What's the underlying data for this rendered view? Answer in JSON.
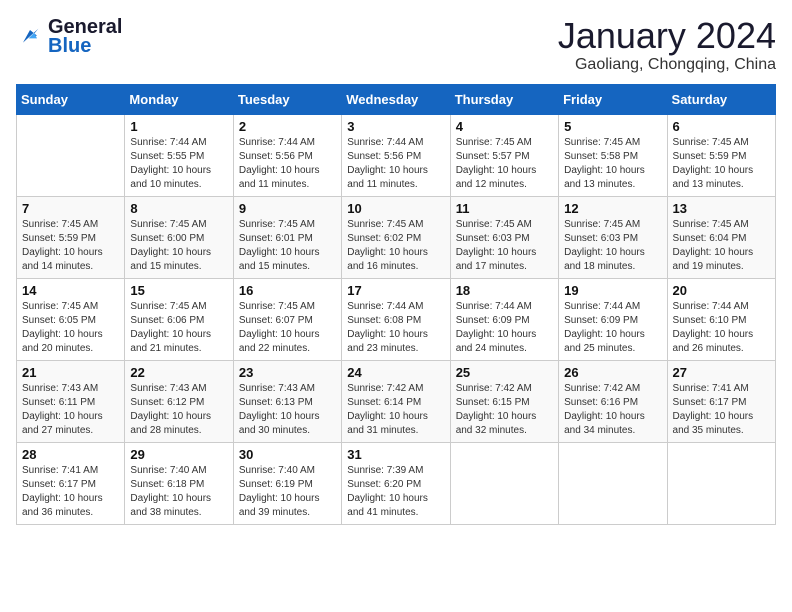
{
  "header": {
    "logo_line1": "General",
    "logo_line2": "Blue",
    "title": "January 2024",
    "subtitle": "Gaoliang, Chongqing, China"
  },
  "weekdays": [
    "Sunday",
    "Monday",
    "Tuesday",
    "Wednesday",
    "Thursday",
    "Friday",
    "Saturday"
  ],
  "weeks": [
    [
      {
        "day": "",
        "info": ""
      },
      {
        "day": "1",
        "info": "Sunrise: 7:44 AM\nSunset: 5:55 PM\nDaylight: 10 hours\nand 10 minutes."
      },
      {
        "day": "2",
        "info": "Sunrise: 7:44 AM\nSunset: 5:56 PM\nDaylight: 10 hours\nand 11 minutes."
      },
      {
        "day": "3",
        "info": "Sunrise: 7:44 AM\nSunset: 5:56 PM\nDaylight: 10 hours\nand 11 minutes."
      },
      {
        "day": "4",
        "info": "Sunrise: 7:45 AM\nSunset: 5:57 PM\nDaylight: 10 hours\nand 12 minutes."
      },
      {
        "day": "5",
        "info": "Sunrise: 7:45 AM\nSunset: 5:58 PM\nDaylight: 10 hours\nand 13 minutes."
      },
      {
        "day": "6",
        "info": "Sunrise: 7:45 AM\nSunset: 5:59 PM\nDaylight: 10 hours\nand 13 minutes."
      }
    ],
    [
      {
        "day": "7",
        "info": "Sunrise: 7:45 AM\nSunset: 5:59 PM\nDaylight: 10 hours\nand 14 minutes."
      },
      {
        "day": "8",
        "info": "Sunrise: 7:45 AM\nSunset: 6:00 PM\nDaylight: 10 hours\nand 15 minutes."
      },
      {
        "day": "9",
        "info": "Sunrise: 7:45 AM\nSunset: 6:01 PM\nDaylight: 10 hours\nand 15 minutes."
      },
      {
        "day": "10",
        "info": "Sunrise: 7:45 AM\nSunset: 6:02 PM\nDaylight: 10 hours\nand 16 minutes."
      },
      {
        "day": "11",
        "info": "Sunrise: 7:45 AM\nSunset: 6:03 PM\nDaylight: 10 hours\nand 17 minutes."
      },
      {
        "day": "12",
        "info": "Sunrise: 7:45 AM\nSunset: 6:03 PM\nDaylight: 10 hours\nand 18 minutes."
      },
      {
        "day": "13",
        "info": "Sunrise: 7:45 AM\nSunset: 6:04 PM\nDaylight: 10 hours\nand 19 minutes."
      }
    ],
    [
      {
        "day": "14",
        "info": "Sunrise: 7:45 AM\nSunset: 6:05 PM\nDaylight: 10 hours\nand 20 minutes."
      },
      {
        "day": "15",
        "info": "Sunrise: 7:45 AM\nSunset: 6:06 PM\nDaylight: 10 hours\nand 21 minutes."
      },
      {
        "day": "16",
        "info": "Sunrise: 7:45 AM\nSunset: 6:07 PM\nDaylight: 10 hours\nand 22 minutes."
      },
      {
        "day": "17",
        "info": "Sunrise: 7:44 AM\nSunset: 6:08 PM\nDaylight: 10 hours\nand 23 minutes."
      },
      {
        "day": "18",
        "info": "Sunrise: 7:44 AM\nSunset: 6:09 PM\nDaylight: 10 hours\nand 24 minutes."
      },
      {
        "day": "19",
        "info": "Sunrise: 7:44 AM\nSunset: 6:09 PM\nDaylight: 10 hours\nand 25 minutes."
      },
      {
        "day": "20",
        "info": "Sunrise: 7:44 AM\nSunset: 6:10 PM\nDaylight: 10 hours\nand 26 minutes."
      }
    ],
    [
      {
        "day": "21",
        "info": "Sunrise: 7:43 AM\nSunset: 6:11 PM\nDaylight: 10 hours\nand 27 minutes."
      },
      {
        "day": "22",
        "info": "Sunrise: 7:43 AM\nSunset: 6:12 PM\nDaylight: 10 hours\nand 28 minutes."
      },
      {
        "day": "23",
        "info": "Sunrise: 7:43 AM\nSunset: 6:13 PM\nDaylight: 10 hours\nand 30 minutes."
      },
      {
        "day": "24",
        "info": "Sunrise: 7:42 AM\nSunset: 6:14 PM\nDaylight: 10 hours\nand 31 minutes."
      },
      {
        "day": "25",
        "info": "Sunrise: 7:42 AM\nSunset: 6:15 PM\nDaylight: 10 hours\nand 32 minutes."
      },
      {
        "day": "26",
        "info": "Sunrise: 7:42 AM\nSunset: 6:16 PM\nDaylight: 10 hours\nand 34 minutes."
      },
      {
        "day": "27",
        "info": "Sunrise: 7:41 AM\nSunset: 6:17 PM\nDaylight: 10 hours\nand 35 minutes."
      }
    ],
    [
      {
        "day": "28",
        "info": "Sunrise: 7:41 AM\nSunset: 6:17 PM\nDaylight: 10 hours\nand 36 minutes."
      },
      {
        "day": "29",
        "info": "Sunrise: 7:40 AM\nSunset: 6:18 PM\nDaylight: 10 hours\nand 38 minutes."
      },
      {
        "day": "30",
        "info": "Sunrise: 7:40 AM\nSunset: 6:19 PM\nDaylight: 10 hours\nand 39 minutes."
      },
      {
        "day": "31",
        "info": "Sunrise: 7:39 AM\nSunset: 6:20 PM\nDaylight: 10 hours\nand 41 minutes."
      },
      {
        "day": "",
        "info": ""
      },
      {
        "day": "",
        "info": ""
      },
      {
        "day": "",
        "info": ""
      }
    ]
  ]
}
